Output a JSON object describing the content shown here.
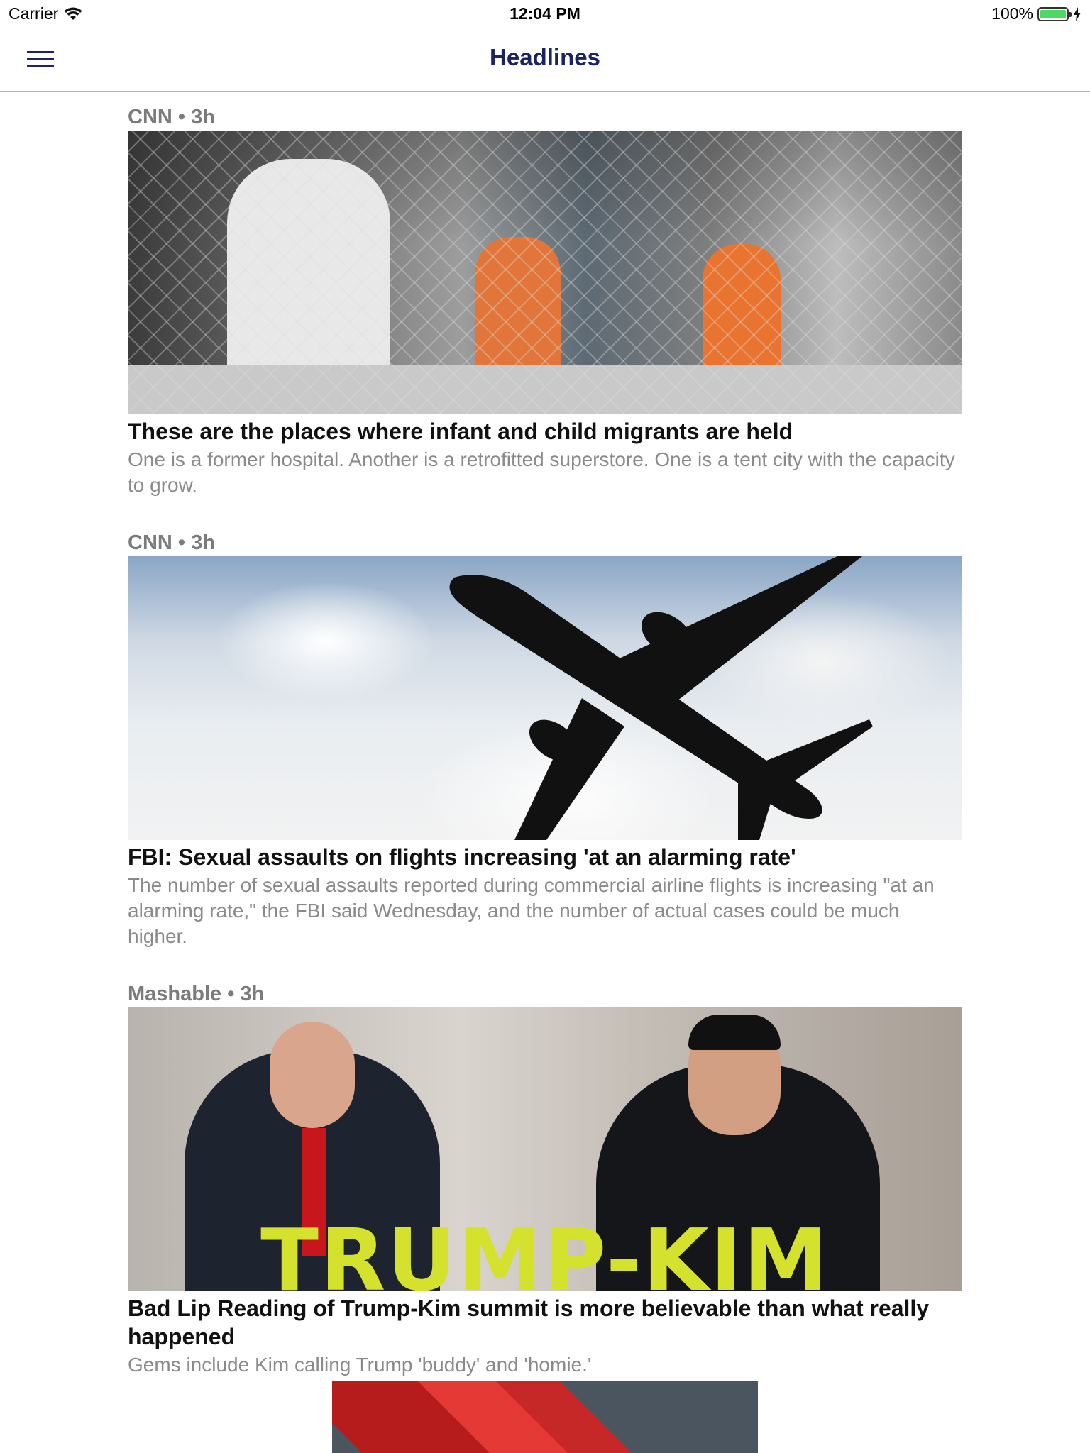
{
  "status_bar": {
    "carrier": "Carrier",
    "time": "12:04 PM",
    "battery": "100%"
  },
  "nav": {
    "title": "Headlines",
    "menu_icon": "hamburger-menu-icon"
  },
  "articles": [
    {
      "meta": "CNN • 3h",
      "headline": "These are the places where infant and child migrants are held",
      "summary": "One is a former hospital. Another is a retrofitted superstore. One is a tent city with the capacity to grow."
    },
    {
      "meta": "CNN • 3h",
      "headline": "FBI: Sexual assaults on flights increasing 'at an alarming rate'",
      "summary": "The number of sexual assaults reported during commercial airline flights is increasing \"at an alarming rate,\" the FBI said Wednesday, and the number of actual cases could be much higher."
    },
    {
      "meta": "Mashable • 3h",
      "headline": "Bad Lip Reading of Trump-Kim summit is more believable than what really happened",
      "summary": "Gems include Kim calling Trump 'buddy' and 'homie.'",
      "image_text": "TRUMP-KIM"
    }
  ],
  "colors": {
    "nav_title": "#1c2361",
    "meta": "#7b7b7b",
    "summary": "#8a8a8a",
    "battery": "#4cd964"
  }
}
